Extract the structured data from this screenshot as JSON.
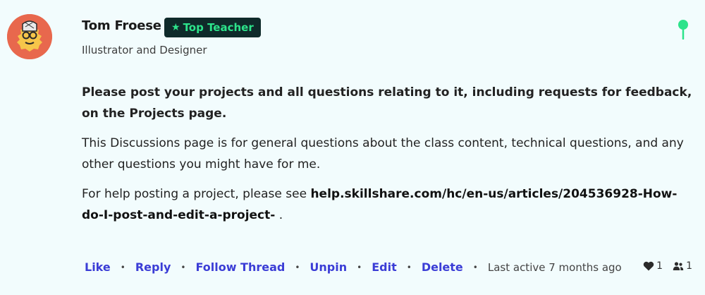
{
  "post": {
    "author": {
      "name": "Tom Froese",
      "badge": "Top Teacher",
      "badge_icon": "star-icon",
      "title": "Illustrator and Designer"
    },
    "pinned": true,
    "colors": {
      "background": "#f2fcfd",
      "badge_bg": "#0f2a2a",
      "badge_text": "#2de38b",
      "action_link": "#3b3dd6",
      "avatar_bg": "#e8684d",
      "pin": "#2de38b"
    },
    "body": {
      "bold_paragraph": "Please post your projects and all questions relating to it, including requests for feedback, on the Projects page.",
      "paragraph": "This Discussions page is for general questions about the class content, technical questions, and any other questions you might have for me.",
      "help_prefix": "For help posting a project, please see ",
      "help_link": "help.skillshare.com/hc/en-us/articles/204536928-How-do-I-post-and-edit-a-project-",
      "help_suffix": " ."
    },
    "actions": {
      "like": "Like",
      "reply": "Reply",
      "follow": "Follow Thread",
      "unpin": "Unpin",
      "edit": "Edit",
      "delete": "Delete",
      "separator": "•",
      "last_active": "Last active 7 months ago"
    },
    "stats": {
      "likes": "1",
      "followers": "1"
    }
  }
}
